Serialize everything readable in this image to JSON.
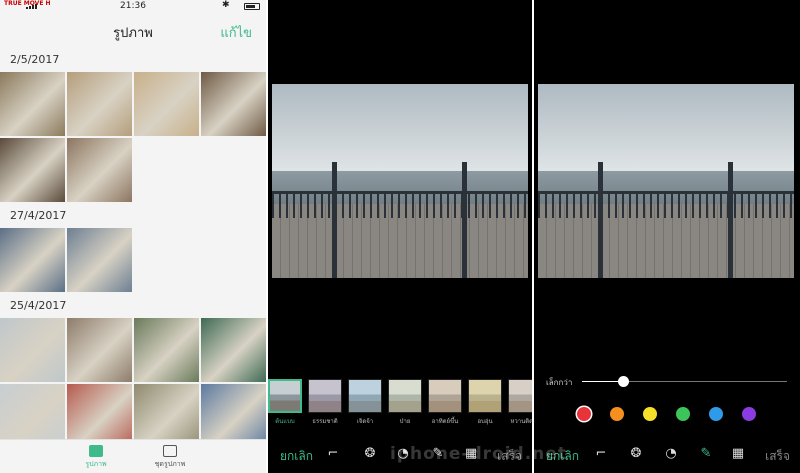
{
  "gallery": {
    "status": {
      "carrier": "TRUE MOVE H",
      "time": "21:36",
      "battery_level": 0.6
    },
    "title": "รูปภาพ",
    "edit_label": "แก้ไข",
    "sections": [
      {
        "date": "2/5/2017",
        "count": 6,
        "colors": [
          "#8b7a5c",
          "#b59e7c",
          "#c8b08a",
          "#6f5a44",
          "#5a4a3a",
          "#8c7560"
        ]
      },
      {
        "date": "27/4/2017",
        "count": 2,
        "colors": [
          "#5b6f86",
          "#6d7f92"
        ]
      },
      {
        "date": "25/4/2017",
        "count": 8,
        "colors": [
          "#bfc7cb",
          "#8d7c6a",
          "#6a7a5a",
          "#3e6a54",
          "#c8ced2",
          "#b65a4e",
          "#8f8a6f",
          "#5c7aa0"
        ]
      }
    ],
    "nav": [
      {
        "label": "รูปภาพ",
        "active": true
      },
      {
        "label": "ชุดรูปภาพ",
        "active": false
      }
    ]
  },
  "filter_editor": {
    "filters": [
      {
        "label": "ต้นแบบ",
        "selected": true,
        "tint": ""
      },
      {
        "label": "ธรรมชาติ",
        "selected": false,
        "tint": "rgba(200,160,190,0.25)"
      },
      {
        "label": "เจิดจ้า",
        "selected": false,
        "tint": "rgba(160,220,255,0.25)"
      },
      {
        "label": "ป่าย",
        "selected": false,
        "tint": "rgba(255,255,200,0.3)"
      },
      {
        "label": "อาทิตย์ขึ้น",
        "selected": false,
        "tint": "rgba(255,200,140,0.3)"
      },
      {
        "label": "อบอุ่น",
        "selected": false,
        "tint": "rgba(255,220,120,0.4)"
      },
      {
        "label": "หวานติดใจ",
        "selected": false,
        "tint": "rgba(255,210,170,0.3)"
      }
    ],
    "cancel_label": "ยกเลิก",
    "done_label": "เสร็จ",
    "tools": [
      "crop-icon",
      "filter-icon",
      "adjust-icon",
      "doodle-icon",
      "mosaic-icon"
    ]
  },
  "doodle_editor": {
    "slider_label": "เล็กกว่า",
    "brush_size": 0.2,
    "colors": [
      "#e8333a",
      "#f5901e",
      "#f7e02a",
      "#3ec55a",
      "#2f9be8",
      "#8a3ce0"
    ],
    "selected_color": 0,
    "cancel_label": "ยกเลิก",
    "done_label": "เสร็จ",
    "tools": [
      "crop-icon",
      "filter-icon",
      "adjust-icon",
      "doodle-icon",
      "mosaic-icon"
    ],
    "active_tool": 3
  },
  "watermark": "iphone-droid.net"
}
